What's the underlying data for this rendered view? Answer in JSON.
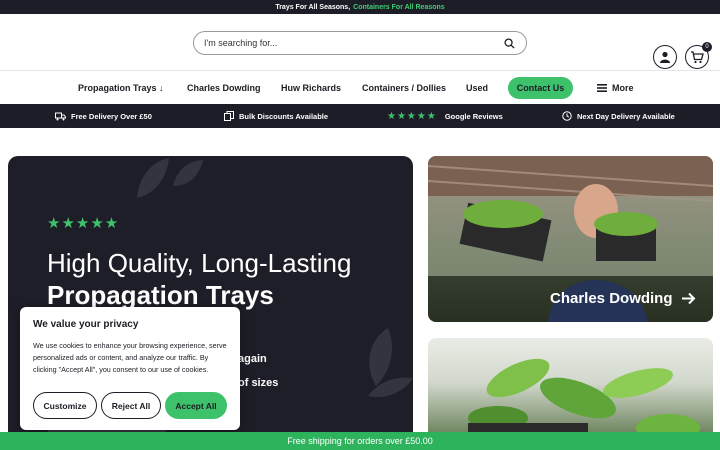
{
  "topbar": {
    "text_plain": "Trays For All Seasons,",
    "text_green": "Containers For All Reasons"
  },
  "header": {
    "search_placeholder": "I'm searching for...",
    "cart_count": "0"
  },
  "nav": {
    "items": [
      "Propagation Trays ↓",
      "Charles Dowding",
      "Huw Richards",
      "Containers / Dollies",
      "Used"
    ],
    "contact": "Contact Us",
    "more": "More"
  },
  "usp": {
    "delivery": "Free Delivery Over £50",
    "bulk": "Bulk Discounts Available",
    "reviews": "Google Reviews",
    "nextday": "Next Day Delivery Available"
  },
  "hero": {
    "title_line1": "High Quality, Long-Lasting",
    "title_line2": "Propagation Trays",
    "bullet1_fragment": "again",
    "bullet2_fragment": "of sizes"
  },
  "cards": {
    "card1_label": "Charles Dowding"
  },
  "cookie": {
    "title": "We value your privacy",
    "body": "We use cookies to enhance your browsing experience, serve personalized ads or content, and analyze our traffic. By clicking \"Accept All\", you consent to our use of cookies.",
    "customize": "Customize",
    "reject": "Reject All",
    "accept": "Accept All"
  },
  "bottombar": {
    "text": "Free shipping for orders over £50.00"
  },
  "colors": {
    "accent": "#3ec16b",
    "dark": "#1d1d28"
  }
}
